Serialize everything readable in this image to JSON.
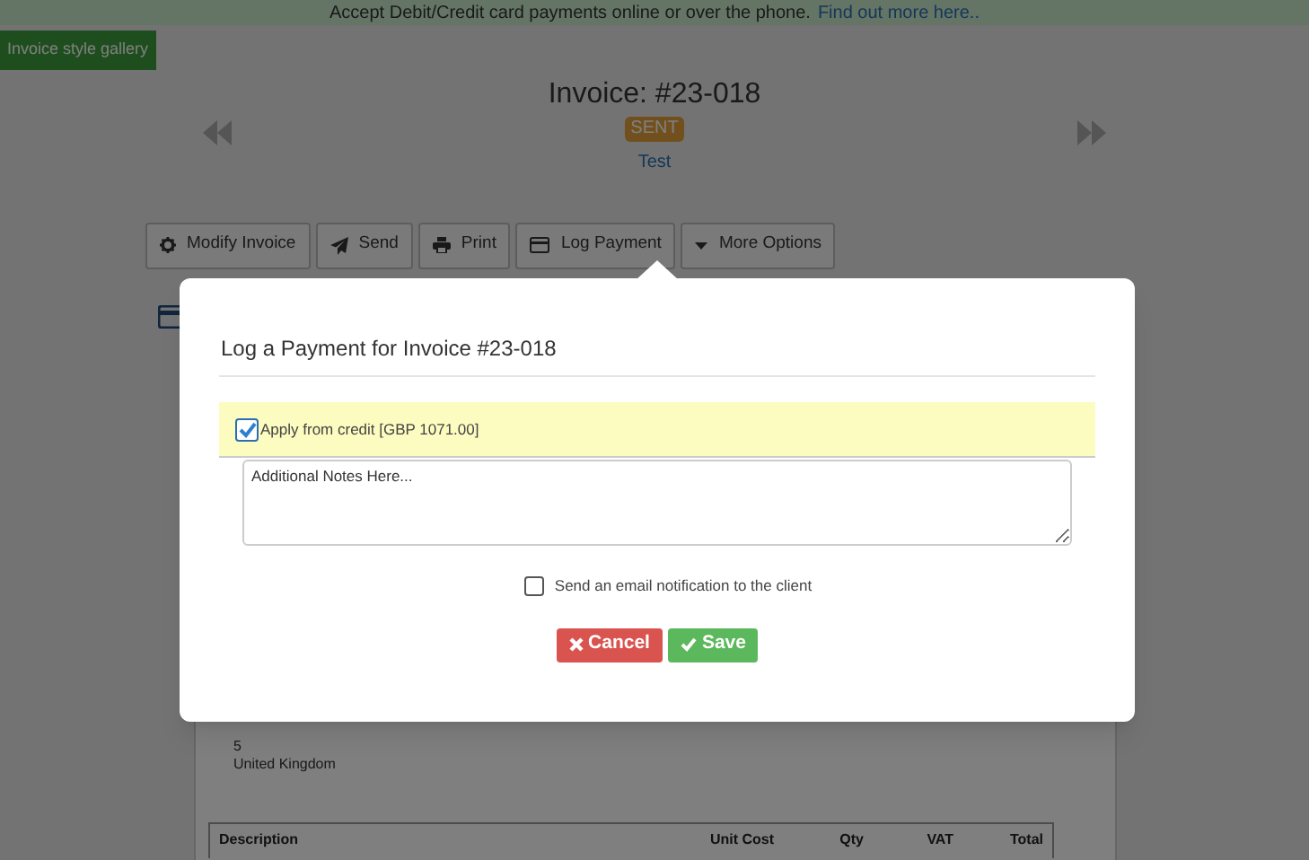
{
  "banner": {
    "text": "Accept Debit/Credit card payments online or over the phone.",
    "link": "Find out more here.."
  },
  "gallery_link": "Invoice style gallery",
  "invoice": {
    "title": "Invoice: #23-018",
    "status": "SENT",
    "client": "Test"
  },
  "toolbar": [
    {
      "label": "Modify Invoice",
      "kind": "gear"
    },
    {
      "label": "Send",
      "kind": "send"
    },
    {
      "label": "Print",
      "kind": "print"
    },
    {
      "label": "Log Payment",
      "kind": "card"
    },
    {
      "label": "More Options",
      "kind": "caret"
    }
  ],
  "address_lines": [
    "5",
    "United Kingdom"
  ],
  "table": {
    "columns": [
      "Description",
      "Unit Cost",
      "Qty",
      "VAT",
      "Total"
    ]
  },
  "modal": {
    "title": "Log a Payment for Invoice #23-018",
    "apply_credit": {
      "label": "Apply from credit [GBP 1071.00]",
      "checked": true
    },
    "notes": {
      "placeholder": "Additional Notes Here..."
    },
    "notify": {
      "label": "Send an email notification to the client",
      "checked": false
    },
    "buttons": [
      {
        "label": "Cancel",
        "kind": "cancel"
      },
      {
        "label": "Save",
        "kind": "save"
      }
    ]
  }
}
